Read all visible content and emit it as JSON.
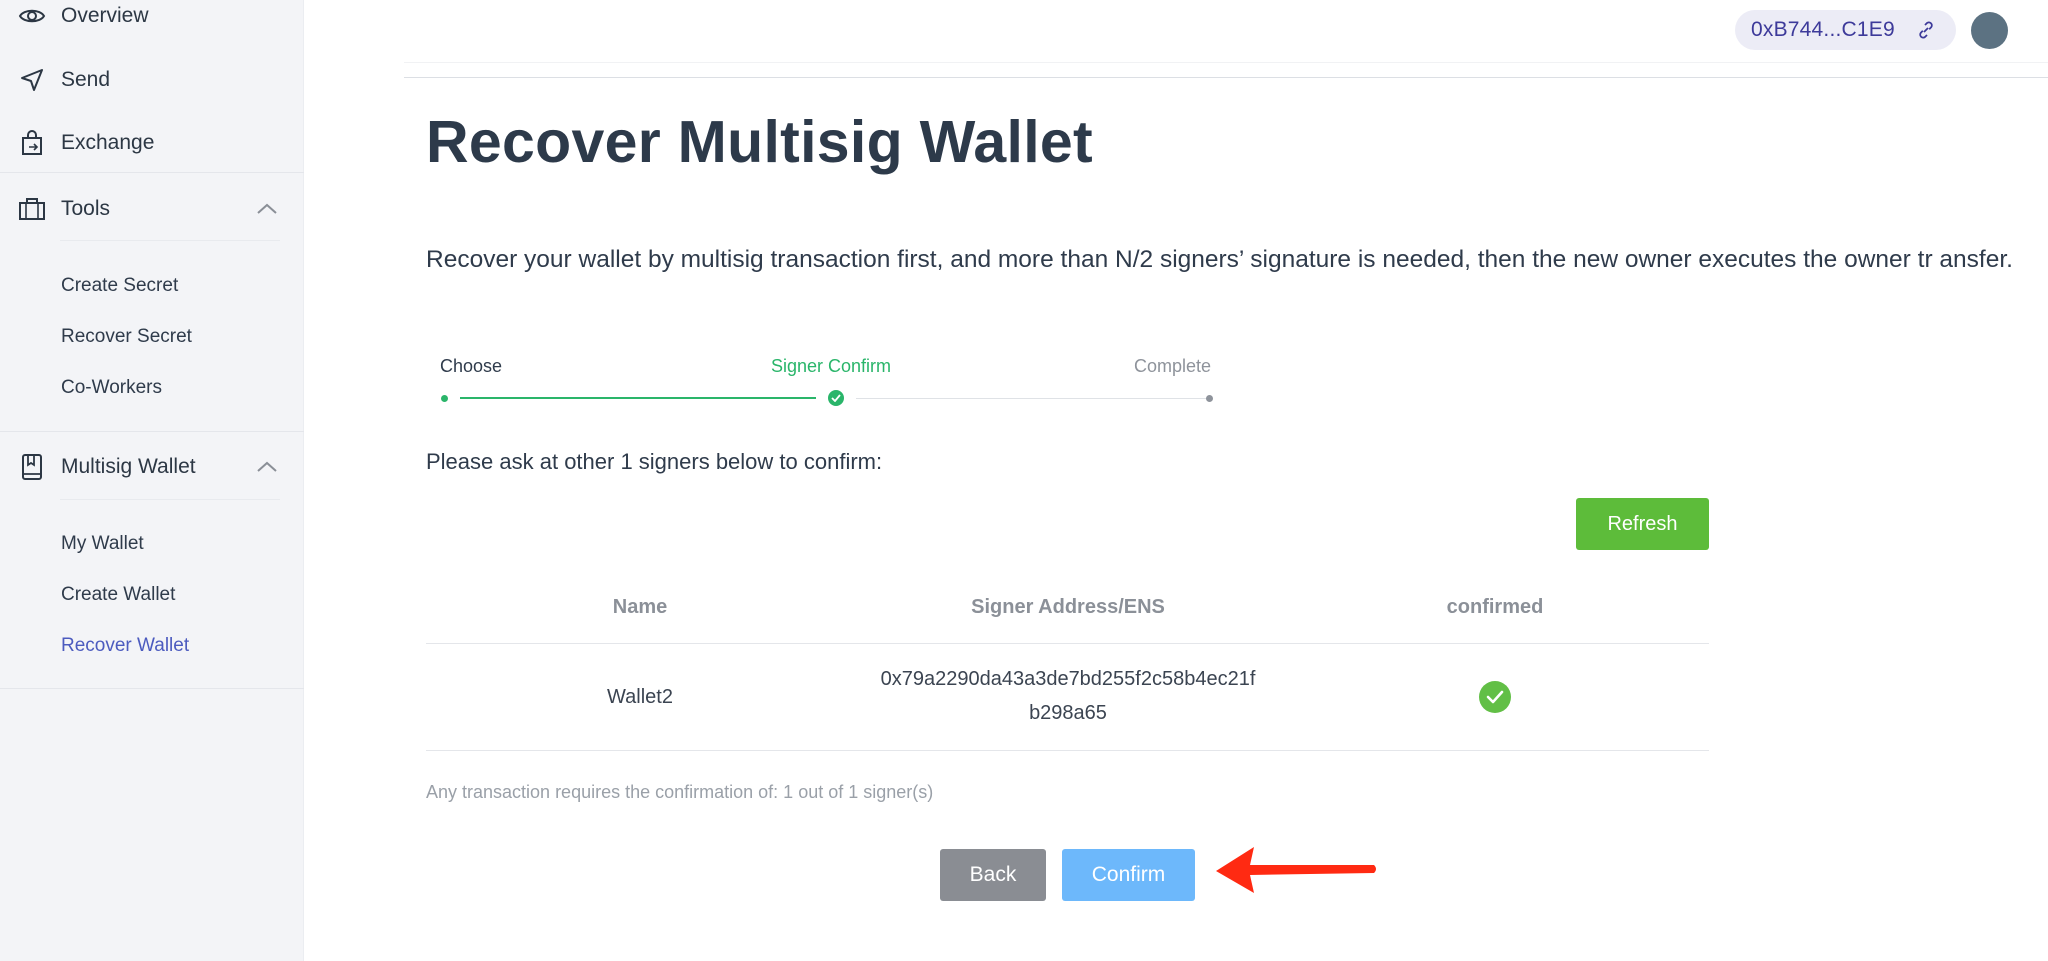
{
  "sidebar": {
    "items": [
      {
        "label": "Overview",
        "icon": "eye-icon"
      },
      {
        "label": "Send",
        "icon": "send-icon"
      },
      {
        "label": "Exchange",
        "icon": "exchange-bag-icon"
      },
      {
        "label": "Tools",
        "icon": "toolbox-icon",
        "expanded": true
      },
      {
        "label": "Multisig Wallet",
        "icon": "wallet-book-icon",
        "expanded": true
      }
    ],
    "tools_sub": [
      "Create Secret",
      "Recover Secret",
      "Co-Workers"
    ],
    "multisig_sub": [
      "My Wallet",
      "Create Wallet",
      "Recover Wallet"
    ],
    "active_sub": "Recover Wallet"
  },
  "header": {
    "address": "0xB744...C1E9",
    "link_icon": "link-icon"
  },
  "main": {
    "title": "Recover Multisig Wallet",
    "description": "Recover your wallet by multisig transaction first, and more than N/2 signers’ signature is needed, then the new owner executes the owner tr ansfer.",
    "steps": [
      "Choose",
      "Signer Confirm",
      "Complete"
    ],
    "current_step": 2,
    "ask_text": "Please ask at other 1 signers below to confirm:",
    "refresh_label": "Refresh",
    "table": {
      "headers": [
        "Name",
        "Signer Address/ENS",
        "confirmed"
      ],
      "rows": [
        {
          "name": "Wallet2",
          "address_line1": "0x79a2290da43a3de7bd255f2c58b4ec21f",
          "address_line2": "b298a65",
          "confirmed": true
        }
      ]
    },
    "footnote": "Any transaction requires the confirmation of: 1 out of 1 signer(s)",
    "back_label": "Back",
    "confirm_label": "Confirm"
  },
  "colors": {
    "accent_green": "#5dbc3a",
    "step_green": "#2ab56a",
    "confirm_blue": "#6db8fb",
    "back_gray": "#8a8d93",
    "active_nav": "#4c5bbf",
    "arrow_red": "#ff2a12"
  }
}
